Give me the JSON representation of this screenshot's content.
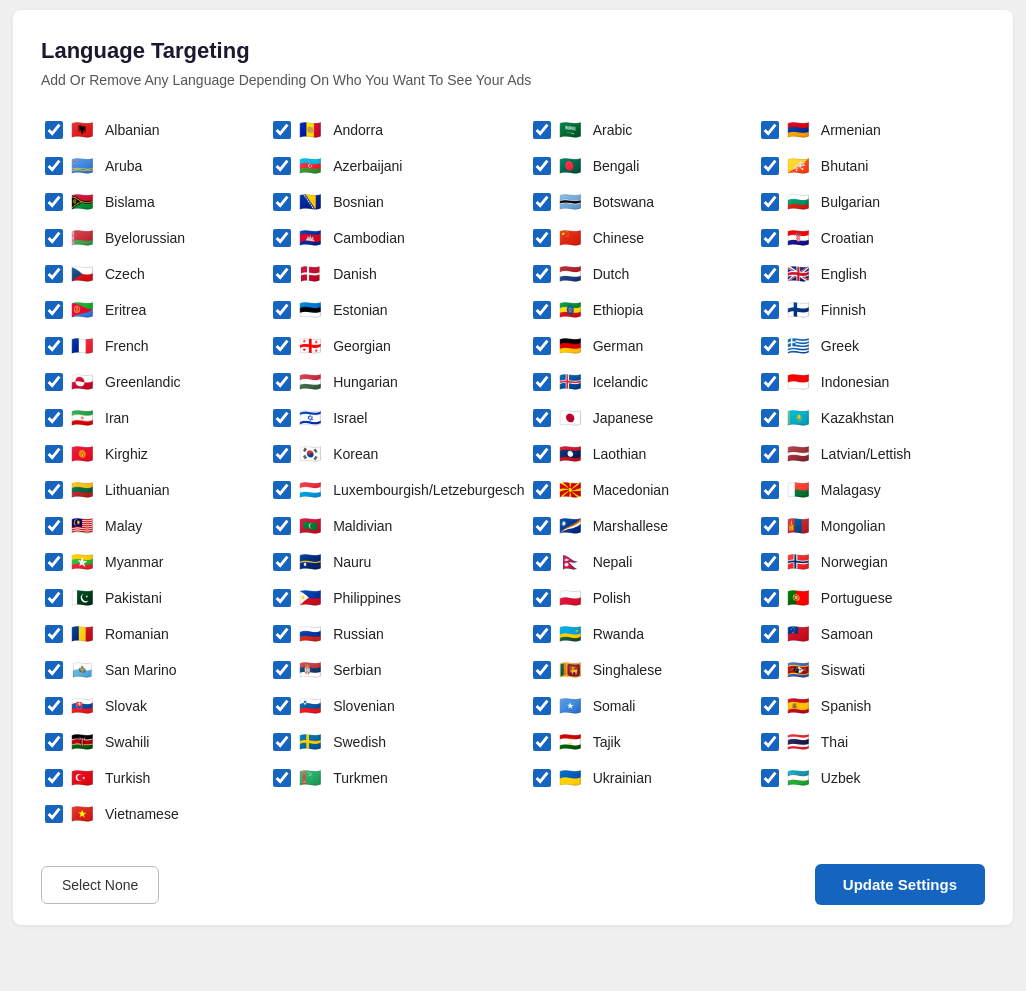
{
  "title": "Language Targeting",
  "subtitle": "Add Or Remove Any Language Depending On Who You Want To See Your Ads",
  "footer": {
    "select_none_label": "Select None",
    "update_label": "Update Settings"
  },
  "languages": [
    {
      "id": "albanian",
      "label": "Albanian",
      "flag": "🇦🇱",
      "checked": true
    },
    {
      "id": "andorra",
      "label": "Andorra",
      "flag": "🇦🇩",
      "checked": true
    },
    {
      "id": "arabic",
      "label": "Arabic",
      "flag": "🇸🇦",
      "checked": true
    },
    {
      "id": "armenian",
      "label": "Armenian",
      "flag": "🇦🇲",
      "checked": true
    },
    {
      "id": "aruba",
      "label": "Aruba",
      "flag": "🇦🇼",
      "checked": true
    },
    {
      "id": "azerbaijani",
      "label": "Azerbaijani",
      "flag": "🇦🇿",
      "checked": true
    },
    {
      "id": "bengali",
      "label": "Bengali",
      "flag": "🇧🇩",
      "checked": true
    },
    {
      "id": "bhutani",
      "label": "Bhutani",
      "flag": "🇧🇹",
      "checked": true
    },
    {
      "id": "bislama",
      "label": "Bislama",
      "flag": "🇻🇺",
      "checked": true
    },
    {
      "id": "bosnian",
      "label": "Bosnian",
      "flag": "🇧🇦",
      "checked": true
    },
    {
      "id": "botswana",
      "label": "Botswana",
      "flag": "🇧🇼",
      "checked": true
    },
    {
      "id": "bulgarian",
      "label": "Bulgarian",
      "flag": "🇧🇬",
      "checked": true
    },
    {
      "id": "byelorussian",
      "label": "Byelorussian",
      "flag": "🇧🇾",
      "checked": true
    },
    {
      "id": "cambodian",
      "label": "Cambodian",
      "flag": "🇰🇭",
      "checked": true
    },
    {
      "id": "chinese",
      "label": "Chinese",
      "flag": "🇨🇳",
      "checked": true
    },
    {
      "id": "croatian",
      "label": "Croatian",
      "flag": "🇭🇷",
      "checked": true
    },
    {
      "id": "czech",
      "label": "Czech",
      "flag": "🇨🇿",
      "checked": true
    },
    {
      "id": "danish",
      "label": "Danish",
      "flag": "🇩🇰",
      "checked": true
    },
    {
      "id": "dutch",
      "label": "Dutch",
      "flag": "🇳🇱",
      "checked": true
    },
    {
      "id": "english",
      "label": "English",
      "flag": "🇬🇧",
      "checked": true
    },
    {
      "id": "eritrea",
      "label": "Eritrea",
      "flag": "🇪🇷",
      "checked": true
    },
    {
      "id": "estonian",
      "label": "Estonian",
      "flag": "🇪🇪",
      "checked": true
    },
    {
      "id": "ethiopia",
      "label": "Ethiopia",
      "flag": "🇪🇹",
      "checked": true
    },
    {
      "id": "finnish",
      "label": "Finnish",
      "flag": "🇫🇮",
      "checked": true
    },
    {
      "id": "french",
      "label": "French",
      "flag": "🇫🇷",
      "checked": true
    },
    {
      "id": "georgian",
      "label": "Georgian",
      "flag": "🇬🇪",
      "checked": true
    },
    {
      "id": "german",
      "label": "German",
      "flag": "🇩🇪",
      "checked": true
    },
    {
      "id": "greek",
      "label": "Greek",
      "flag": "🇬🇷",
      "checked": true
    },
    {
      "id": "greenlandic",
      "label": "Greenlandic",
      "flag": "🇬🇱",
      "checked": true
    },
    {
      "id": "hungarian",
      "label": "Hungarian",
      "flag": "🇭🇺",
      "checked": true
    },
    {
      "id": "icelandic",
      "label": "Icelandic",
      "flag": "🇮🇸",
      "checked": true
    },
    {
      "id": "indonesian",
      "label": "Indonesian",
      "flag": "🇮🇩",
      "checked": true
    },
    {
      "id": "iran",
      "label": "Iran",
      "flag": "🇮🇷",
      "checked": true
    },
    {
      "id": "israel",
      "label": "Israel",
      "flag": "🇮🇱",
      "checked": true
    },
    {
      "id": "japanese",
      "label": "Japanese",
      "flag": "🇯🇵",
      "checked": true
    },
    {
      "id": "kazakhstan",
      "label": "Kazakhstan",
      "flag": "🇰🇿",
      "checked": true
    },
    {
      "id": "kirghiz",
      "label": "Kirghiz",
      "flag": "🇰🇬",
      "checked": true
    },
    {
      "id": "korean",
      "label": "Korean",
      "flag": "🇰🇷",
      "checked": true
    },
    {
      "id": "laothian",
      "label": "Laothian",
      "flag": "🇱🇦",
      "checked": true
    },
    {
      "id": "latvian",
      "label": "Latvian/Lettish",
      "flag": "🇱🇻",
      "checked": true
    },
    {
      "id": "lithuanian",
      "label": "Lithuanian",
      "flag": "🇱🇹",
      "checked": true
    },
    {
      "id": "luxembourgish",
      "label": "Luxembourgish/Letzeburgesch",
      "flag": "🇱🇺",
      "checked": true
    },
    {
      "id": "macedonian",
      "label": "Macedonian",
      "flag": "🇲🇰",
      "checked": true
    },
    {
      "id": "malagasy",
      "label": "Malagasy",
      "flag": "🇲🇬",
      "checked": true
    },
    {
      "id": "malay",
      "label": "Malay",
      "flag": "🇲🇾",
      "checked": true
    },
    {
      "id": "maldivian",
      "label": "Maldivian",
      "flag": "🇲🇻",
      "checked": true
    },
    {
      "id": "marshallese",
      "label": "Marshallese",
      "flag": "🇲🇭",
      "checked": true
    },
    {
      "id": "mongolian",
      "label": "Mongolian",
      "flag": "🇲🇳",
      "checked": true
    },
    {
      "id": "myanmar",
      "label": "Myanmar",
      "flag": "🇲🇲",
      "checked": true
    },
    {
      "id": "nauru",
      "label": "Nauru",
      "flag": "🇳🇷",
      "checked": true
    },
    {
      "id": "nepali",
      "label": "Nepali",
      "flag": "🇳🇵",
      "checked": true
    },
    {
      "id": "norwegian",
      "label": "Norwegian",
      "flag": "🇳🇴",
      "checked": true
    },
    {
      "id": "pakistani",
      "label": "Pakistani",
      "flag": "🇵🇰",
      "checked": true
    },
    {
      "id": "philippines",
      "label": "Philippines",
      "flag": "🇵🇭",
      "checked": true
    },
    {
      "id": "polish",
      "label": "Polish",
      "flag": "🇵🇱",
      "checked": true
    },
    {
      "id": "portuguese",
      "label": "Portuguese",
      "flag": "🇵🇹",
      "checked": true
    },
    {
      "id": "romanian",
      "label": "Romanian",
      "flag": "🇷🇴",
      "checked": true
    },
    {
      "id": "russian",
      "label": "Russian",
      "flag": "🇷🇺",
      "checked": true
    },
    {
      "id": "rwanda",
      "label": "Rwanda",
      "flag": "🇷🇼",
      "checked": true
    },
    {
      "id": "samoan",
      "label": "Samoan",
      "flag": "🇼🇸",
      "checked": true
    },
    {
      "id": "sanmarino",
      "label": "San Marino",
      "flag": "🇸🇲",
      "checked": true
    },
    {
      "id": "serbian",
      "label": "Serbian",
      "flag": "🇷🇸",
      "checked": true
    },
    {
      "id": "singhalese",
      "label": "Singhalese",
      "flag": "🇱🇰",
      "checked": true
    },
    {
      "id": "siswati",
      "label": "Siswati",
      "flag": "🇸🇿",
      "checked": true
    },
    {
      "id": "slovak",
      "label": "Slovak",
      "flag": "🇸🇰",
      "checked": true
    },
    {
      "id": "slovenian",
      "label": "Slovenian",
      "flag": "🇸🇮",
      "checked": true
    },
    {
      "id": "somali",
      "label": "Somali",
      "flag": "🇸🇴",
      "checked": true
    },
    {
      "id": "spanish",
      "label": "Spanish",
      "flag": "🇪🇸",
      "checked": true
    },
    {
      "id": "swahili",
      "label": "Swahili",
      "flag": "🇰🇪",
      "checked": true
    },
    {
      "id": "swedish",
      "label": "Swedish",
      "flag": "🇸🇪",
      "checked": true
    },
    {
      "id": "tajik",
      "label": "Tajik",
      "flag": "🇹🇯",
      "checked": true
    },
    {
      "id": "thai",
      "label": "Thai",
      "flag": "🇹🇭",
      "checked": true
    },
    {
      "id": "turkish",
      "label": "Turkish",
      "flag": "🇹🇷",
      "checked": true
    },
    {
      "id": "turkmen",
      "label": "Turkmen",
      "flag": "🇹🇲",
      "checked": true
    },
    {
      "id": "ukrainian",
      "label": "Ukrainian",
      "flag": "🇺🇦",
      "checked": true
    },
    {
      "id": "uzbek",
      "label": "Uzbek",
      "flag": "🇺🇿",
      "checked": true
    },
    {
      "id": "vietnamese",
      "label": "Vietnamese",
      "flag": "🇻🇳",
      "checked": true
    }
  ]
}
